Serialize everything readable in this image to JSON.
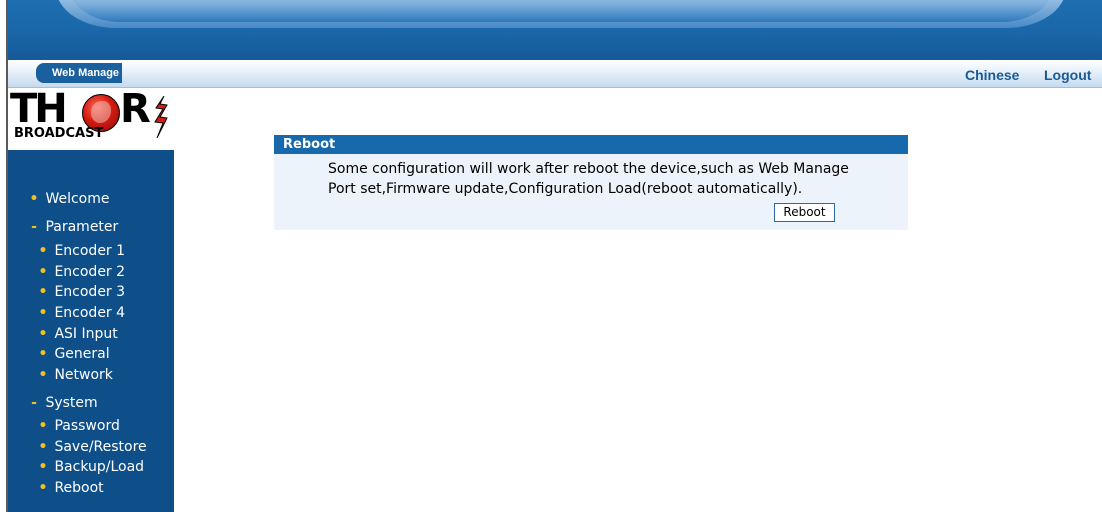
{
  "header": {
    "web_manage_label": "Web Manage",
    "links": {
      "chinese": "Chinese",
      "logout": "Logout"
    }
  },
  "logo": {
    "brand_top": "THOR",
    "brand_bottom": "BROADCAST"
  },
  "sidebar": {
    "items": [
      {
        "label": "Welcome",
        "bullet": "•"
      },
      {
        "label": "Parameter",
        "bullet": "-"
      },
      {
        "label": "Encoder 1",
        "bullet": "•"
      },
      {
        "label": "Encoder 2",
        "bullet": "•"
      },
      {
        "label": "Encoder 3",
        "bullet": "•"
      },
      {
        "label": "Encoder 4",
        "bullet": "•"
      },
      {
        "label": "ASI Input",
        "bullet": "•"
      },
      {
        "label": "General",
        "bullet": "•"
      },
      {
        "label": "Network",
        "bullet": "•"
      },
      {
        "label": "System",
        "bullet": "-"
      },
      {
        "label": "Password",
        "bullet": "•"
      },
      {
        "label": "Save/Restore",
        "bullet": "•"
      },
      {
        "label": "Backup/Load",
        "bullet": "•"
      },
      {
        "label": "Reboot",
        "bullet": "•"
      }
    ]
  },
  "panel": {
    "title": "Reboot",
    "message_line1": "Some configuration will work after reboot the device,such as Web Manage",
    "message_line2": "Port set,Firmware update,Configuration Load(reboot automatically).",
    "button_label": "Reboot"
  },
  "colors": {
    "sidebar_bg": "#0e4f8a",
    "panel_header": "#1669ad",
    "panel_bg": "#edf3fa",
    "link": "#1a5a96",
    "bullet": "#f0c020"
  }
}
